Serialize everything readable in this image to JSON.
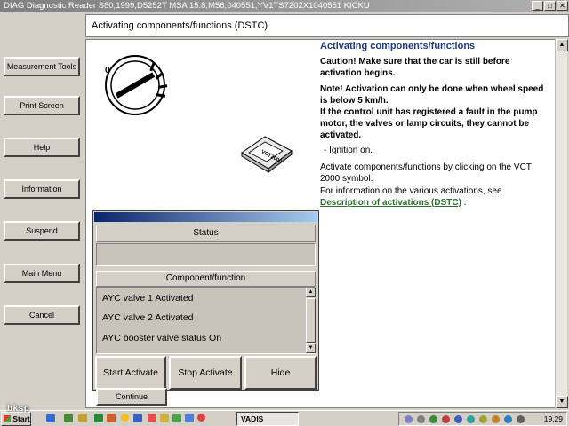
{
  "window": {
    "title": "DIAG Diagnostic Reader S80,1999,D5252T MSA 15.8,M56,040551,YV1TS7202X1040551 KICKU"
  },
  "sidebar": {
    "items": [
      {
        "label": "Measurement Tools"
      },
      {
        "label": "Print Screen"
      },
      {
        "label": "Help"
      },
      {
        "label": "Information"
      },
      {
        "label": "Suspend"
      },
      {
        "label": "Main Menu"
      },
      {
        "label": "Cancel"
      }
    ]
  },
  "header": {
    "title": "Activating components/functions (DSTC)"
  },
  "illustration": {
    "device_label": "VCT2000"
  },
  "content": {
    "title": "Activating components/functions",
    "caution": "Caution! Make sure that the car is still before activation begins.",
    "note": "Note! Activation can only be done when wheel speed is below 5 km/h.",
    "fault_note": "If the control unit has registered a fault in the pump motor, the valves or lamp circuits, they cannot be activated.",
    "list_item": "-  Ignition on.",
    "instruction": "Activate components/functions by clicking on the VCT 2000 symbol.",
    "info_prefix": "For information on the various activations, see",
    "link_text": "Description of activations (DSTC)",
    "link_suffix": " ."
  },
  "dialog": {
    "status_header": "Status",
    "status_value": "",
    "component_header": "Component/function",
    "items": [
      "AYC valve 1 Activated",
      "AYC valve 2 Activated",
      "AYC booster valve status On"
    ],
    "start_button": "Start Activate",
    "stop_button": "Stop Activate",
    "hide_button": "Hide"
  },
  "continue_button": "Continue",
  "taskbar": {
    "start_label": "Start",
    "task_label": "VADIS",
    "clock": "19.29"
  },
  "watermark": "bksp",
  "colors": {
    "content_title": "#1a3a80",
    "link": "#2a6e2a",
    "dialog_title_start": "#0a246a",
    "dialog_title_end": "#a6caf0"
  }
}
